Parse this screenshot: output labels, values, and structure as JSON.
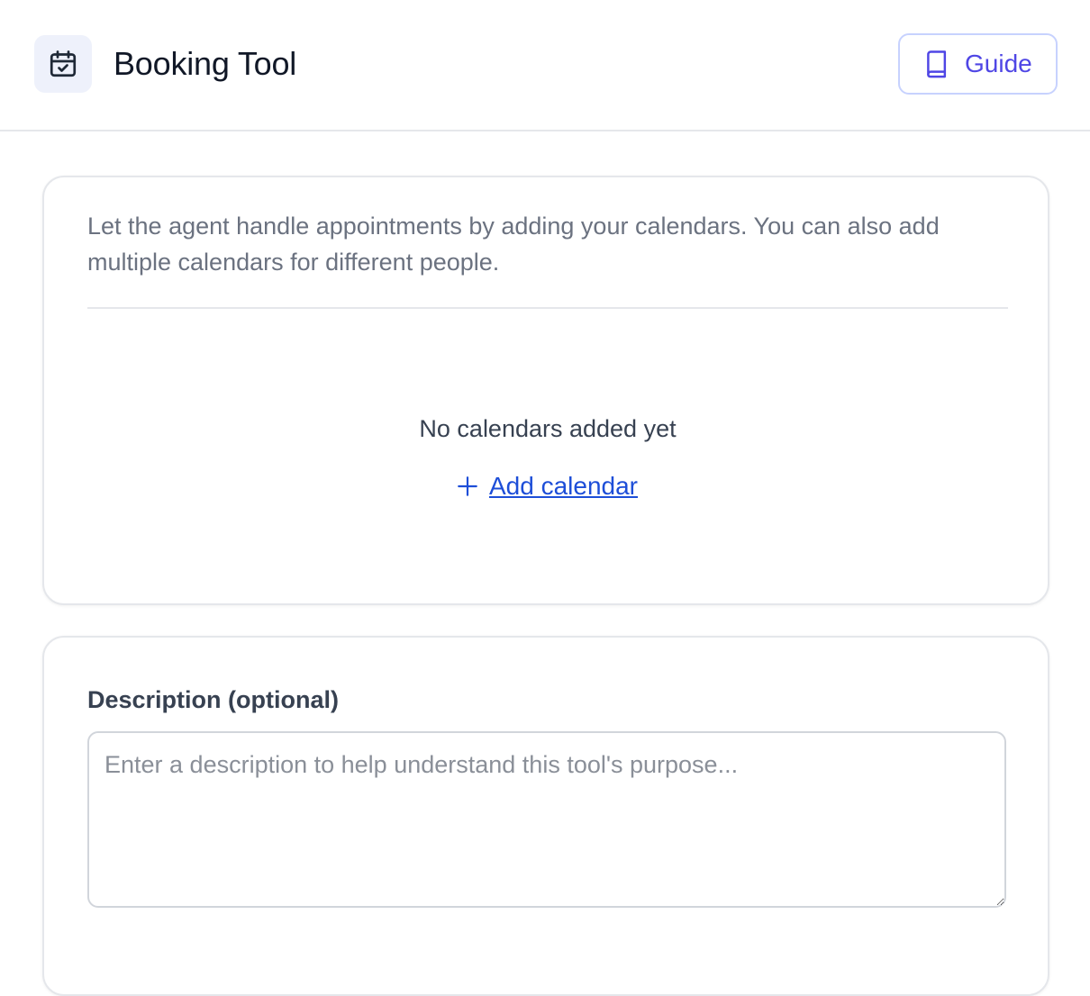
{
  "header": {
    "title": "Booking Tool",
    "app_icon": "calendar-check-icon",
    "guide_button": {
      "label": "Guide",
      "icon": "book-icon"
    }
  },
  "calendars_card": {
    "intro": "Let the agent handle appointments by adding your calendars. You can also add multiple calendars for different people.",
    "empty_state": "No calendars added yet",
    "add_link": {
      "label": "Add calendar",
      "icon": "plus-icon"
    }
  },
  "description_card": {
    "label": "Description (optional)",
    "placeholder": "Enter a description to help understand this tool's purpose...",
    "value": ""
  },
  "colors": {
    "accent": "#4f46e5",
    "link": "#1d4ed8",
    "border": "#e5e7eb",
    "muted_text": "#6b7280"
  }
}
